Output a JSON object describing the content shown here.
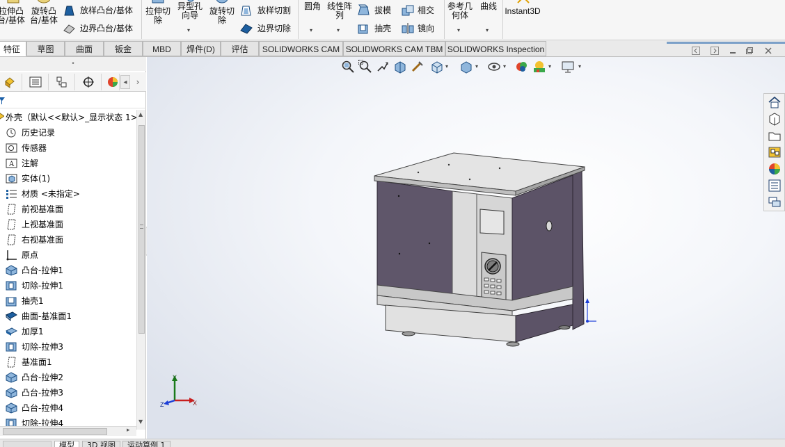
{
  "ribbon": {
    "extrude_boss": "拉伸凸\n台/基体",
    "revolve_boss": "旋转凸\n台/基体",
    "loft_boss": "放样凸台/基体",
    "boundary_boss": "边界凸台/基体",
    "extrude_cut": "拉伸切\n除",
    "hole_wizard": "异型孔\n向导",
    "revolve_cut": "旋转切\n除",
    "loft_cut": "放样切割",
    "boundary_cut": "边界切除",
    "fillet": "圆角",
    "linear_pattern": "线性阵\n列",
    "draft": "拔模",
    "intersect": "相交",
    "shell": "抽壳",
    "mirror": "镜向",
    "ref_geometry": "参考几\n何体",
    "curves": "曲线",
    "instant3d": "Instant3D"
  },
  "tabs": [
    "特征",
    "草图",
    "曲面",
    "钣金",
    "MBD",
    "焊件(D)",
    "评估",
    "SOLIDWORKS CAM",
    "SOLIDWORKS CAM TBM",
    "SOLIDWORKS Inspection"
  ],
  "feature_tree": {
    "root": "外壳（默认<<默认>_显示状态 1>",
    "items": [
      "历史记录",
      "传感器",
      "注解",
      "实体(1)",
      "材质 <未指定>",
      "前视基准面",
      "上视基准面",
      "右视基准面",
      "原点",
      "凸台-拉伸1",
      "切除-拉伸1",
      "抽壳1",
      "曲面-基准面1",
      "加厚1",
      "切除-拉伸3",
      "基准面1",
      "凸台-拉伸2",
      "凸台-拉伸3",
      "凸台-拉伸4",
      "切除-拉伸4"
    ],
    "icons": [
      "history-icon",
      "sensor-icon",
      "annotation-icon",
      "solid-body-icon",
      "material-icon",
      "plane-icon",
      "plane-icon",
      "plane-icon",
      "origin-icon",
      "boss-extrude-icon",
      "cut-extrude-icon",
      "shell-icon",
      "planar-surface-icon",
      "thicken-icon",
      "cut-extrude-icon",
      "plane-icon",
      "boss-extrude-icon",
      "boss-extrude-icon",
      "boss-extrude-icon",
      "cut-extrude-icon"
    ]
  },
  "bottom_tabs": [
    "模型",
    "3D 视图",
    "运动算例 1"
  ],
  "triad": {
    "x": "X",
    "y": "Y",
    "z": "Z"
  },
  "colors": {
    "accent": "#1b5fa8",
    "body_face": "#5d5466",
    "body_front": "#d8d8d8",
    "viewport_bg": "#eef1f6"
  }
}
